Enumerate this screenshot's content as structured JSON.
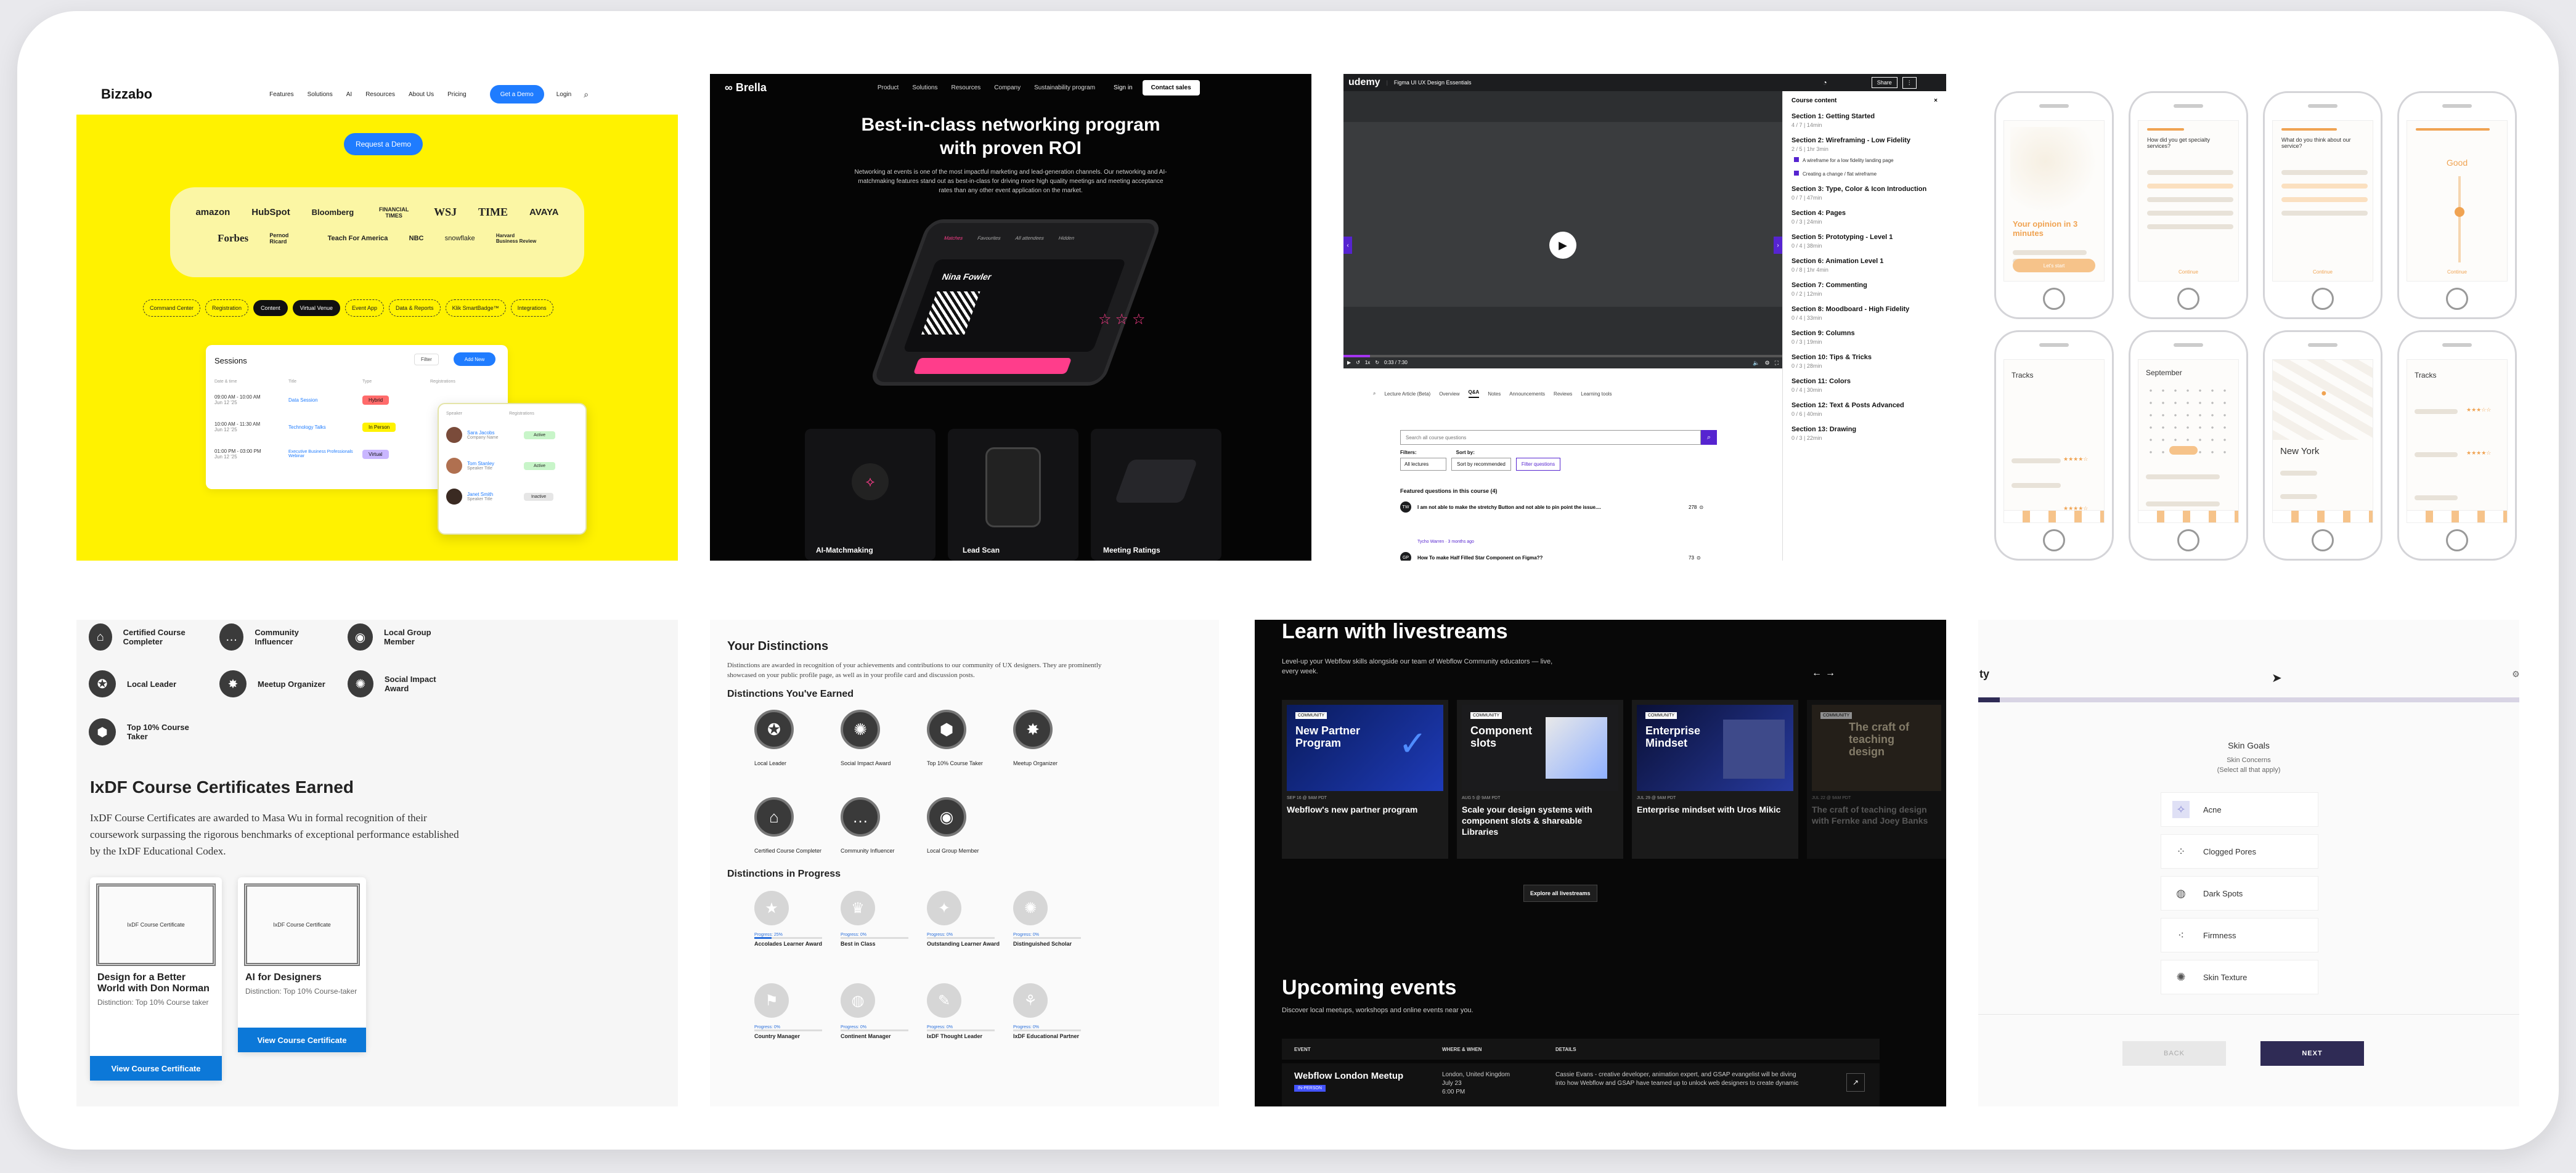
{
  "bizzabo": {
    "logo": "Bizzabo",
    "nav": [
      "Features",
      "Solutions",
      "AI",
      "Resources",
      "About Us",
      "Pricing"
    ],
    "cta": "Get a Demo",
    "login": "Login",
    "hero_button": "Request a Demo",
    "logos_row1": [
      "amazon",
      "HubSpot",
      "Bloomberg",
      "FINANCIAL TIMES",
      "WSJ",
      "TIME",
      "AVAYA"
    ],
    "logos_row2": [
      "Forbes",
      "Pernod Ricard",
      "Teach For America",
      "NBC",
      "snowflake",
      "Harvard Business Review"
    ],
    "chips": [
      "Command Center",
      "Registration",
      "Content",
      "Virtual Venue",
      "Event App",
      "Data & Reports",
      "Klik SmartBadge™",
      "Integrations"
    ],
    "card_title": "Sessions",
    "card_select": "Filter",
    "card_button": "Add New",
    "table_headers": [
      "Date & time",
      "Title",
      "Type",
      "Registrations"
    ],
    "rows": [
      {
        "date": "09:00 AM - 10:00 AM",
        "day": "Jun 12 '25",
        "title": "Data Session",
        "type": "Hybrid"
      },
      {
        "date": "10:00 AM - 11:30 AM",
        "day": "Jun 12 '25",
        "title": "Technology Talks",
        "type": "In Person"
      },
      {
        "date": "01:00 PM - 03:00 PM",
        "day": "Jun 12 '25",
        "title": "Executive Business Professionals Webinar",
        "type": "Virtual"
      }
    ],
    "popup_headers": [
      "Speaker",
      "Registrations"
    ],
    "popup_people": [
      {
        "name": "Sara Jacobs",
        "role": "Company Name",
        "status": "Active"
      },
      {
        "name": "Tom Stanley",
        "role": "Speaker Title",
        "status": "Active"
      },
      {
        "name": "Janet Smith",
        "role": "Speaker Title",
        "status": "Inactive"
      }
    ]
  },
  "brella": {
    "logo": "Brella",
    "nav": [
      "Product",
      "Solutions",
      "Resources",
      "Company",
      "Sustainability program"
    ],
    "signin": "Sign in",
    "cta": "Contact sales",
    "headline_1": "Best-in-class networking program",
    "headline_2": "with proven ROI",
    "paragraph": "Networking at events is one of the most impactful marketing and lead-generation channels. Our networking and AI-matchmaking features stand out as best-in-class for driving more high quality meetings and meeting acceptance rates than any other event application on the market.",
    "phone_name": "Nina Fowler",
    "phone_tabs": [
      "Matches",
      "Favourites",
      "All attendees",
      "Hidden"
    ],
    "features": [
      "AI-Matchmaking",
      "Lead Scan",
      "Meeting Ratings"
    ]
  },
  "udemy": {
    "logo": "udemy",
    "course_title": "Figma UI UX Design Essentials",
    "topbar_button": "Share",
    "sidebar_title": "Course content",
    "sections": [
      {
        "title": "Section 1: Getting Started",
        "meta": "4 / 7 | 14min"
      },
      {
        "title": "Section 2: Wireframing - Low Fidelity",
        "meta": "2 / 5 | 1hr 3min"
      },
      {
        "title": "Section 3: Type, Color & Icon Introduction",
        "meta": "0 / 7 | 47min"
      },
      {
        "title": "Section 4: Pages",
        "meta": "0 / 3 | 24min"
      },
      {
        "title": "Section 5: Prototyping - Level 1",
        "meta": "0 / 4 | 38min"
      },
      {
        "title": "Section 6: Animation Level 1",
        "meta": "0 / 8 | 1hr 4min"
      },
      {
        "title": "Section 7: Commenting",
        "meta": "0 / 2 | 12min"
      },
      {
        "title": "Section 8: Moodboard - High Fidelity",
        "meta": "0 / 4 | 33min"
      },
      {
        "title": "Section 9: Columns",
        "meta": "0 / 3 | 19min"
      },
      {
        "title": "Section 10: Tips & Tricks",
        "meta": "0 / 3 | 28min"
      },
      {
        "title": "Section 11: Colors",
        "meta": "0 / 4 | 30min"
      },
      {
        "title": "Section 12: Text & Posts Advanced",
        "meta": "0 / 6 | 40min"
      },
      {
        "title": "Section 13: Drawing",
        "meta": "0 / 3 | 22min"
      }
    ],
    "lectures": [
      "A wireframe for a low fidelity landing page",
      "Creating a change / flat wireframe"
    ],
    "time": "0:33 / 7:30",
    "tabs": [
      "Lecture Article (Beta)",
      "Overview",
      "Q&A",
      "Notes",
      "Announcements",
      "Reviews",
      "Learning tools"
    ],
    "search_placeholder": "Search all course questions",
    "filters_label": "Filters:",
    "sort_label": "Sort by:",
    "filter_buttons": [
      "All lectures",
      "Sort by recommended",
      "Filter questions"
    ],
    "featured": "Featured questions in this course (4)",
    "questions": [
      {
        "text": "I am not able to make the stretchy Button and not able to pin point the issue....",
        "count": "278"
      },
      {
        "text": "How To make Half Filled Star Component on Figma??",
        "count": "73"
      }
    ],
    "question_meta": "Tycho Warren · 3 months ago"
  },
  "mobile": {
    "phones": [
      {
        "title": "Your opinion in 3 minutes",
        "button": "Let's start"
      },
      {
        "title": "How did you get specialty services?",
        "button": "Continue"
      },
      {
        "title": "What do you think about our service?",
        "button": "Continue"
      },
      {
        "title": "Good",
        "button": "Continue"
      },
      {
        "title": "Tracks",
        "button": ""
      },
      {
        "title": "September",
        "button": ""
      },
      {
        "title": "New York",
        "button": ""
      },
      {
        "title": "Tracks",
        "button": ""
      }
    ],
    "accent": "#f0a352"
  },
  "ixdf": {
    "badges": [
      "Certified Course Completer",
      "Community Influencer",
      "Local Group Member",
      "Local Leader",
      "Meetup Organizer",
      "Social Impact Award",
      "Top 10% Course Taker"
    ],
    "heading": "IxDF Course Certificates Earned",
    "paragraph": "IxDF Course Certificates are awarded to Masa Wu in formal recognition of their coursework surpassing the rigorous benchmarks of exceptional performance established by the IxDF Educational Codex.",
    "cert_caption": "IxDF Course Certificate",
    "certs": [
      {
        "title": "Design for a Better World with Don Norman",
        "distinction": "Distinction: Top 10% Course taker",
        "button": "View Course Certificate"
      },
      {
        "title": "AI for Designers",
        "distinction": "Distinction: Top 10% Course-taker",
        "button": "View Course Certificate"
      }
    ]
  },
  "distinctions": {
    "title": "Your Distinctions",
    "intro": "Distinctions are awarded in recognition of your achievements and contributions to our community of UX designers. They are prominently showcased on your public profile page, as well as in your profile card and discussion posts.",
    "earned_title": "Distinctions You've Earned",
    "earned": [
      "Local Leader",
      "Social Impact Award",
      "Top 10% Course Taker",
      "Meetup Organizer",
      "Certified Course Completer",
      "Community Influencer",
      "Local Group Member"
    ],
    "progress_title": "Distinctions in Progress",
    "progress": [
      {
        "label": "Progress: 25%",
        "name": "Accolades Learner Award"
      },
      {
        "label": "Progress: 0%",
        "name": "Best in Class"
      },
      {
        "label": "Progress: 0%",
        "name": "Outstanding Learner Award"
      },
      {
        "label": "Progress: 0%",
        "name": "Distinguished Scholar"
      },
      {
        "label": "Progress: 0%",
        "name": "Country Manager"
      },
      {
        "label": "Progress: 0%",
        "name": "Continent Manager"
      },
      {
        "label": "Progress: 0%",
        "name": "IxDF Thought Leader"
      },
      {
        "label": "Progress: 0%",
        "name": "IxDF Educational Partner"
      }
    ]
  },
  "webflow": {
    "title": "Learn with livestreams",
    "subtitle": "Level-up your Webflow skills alongside our team of Webflow Community educators — live, every week.",
    "cards": [
      {
        "thumb": "New Partner Program",
        "tag": "COMMUNITY",
        "date": "SEP 16 @ 9AM PDT",
        "title": "Webflow's new partner program"
      },
      {
        "thumb": "Component slots",
        "tag": "COMMUNITY",
        "date": "AUG 5 @ 9AM PDT",
        "title": "Scale your design systems with component slots & shareable Libraries"
      },
      {
        "thumb": "Enterprise Mindset",
        "tag": "COMMUNITY",
        "date": "JUL 29 @ 9AM PDT",
        "title": "Enterprise mindset with Uros Mikic"
      },
      {
        "thumb": "The craft of teaching design",
        "tag": "COMMUNITY",
        "date": "JUL 22 @ 9AM PDT",
        "title": "The craft of teaching design with Fernke and Joey Banks"
      }
    ],
    "explore": "Explore all livestreams",
    "events_title": "Upcoming events",
    "events_sub": "Discover local meetups, workshops and online events near you.",
    "cols": [
      "EVENT",
      "WHERE & WHEN",
      "DETAILS"
    ],
    "event_name": "Webflow London Meetup",
    "event_tag": "IN-PERSON",
    "event_where": "London, United Kingdom",
    "event_when": "July 23",
    "event_time": "6:00 PM",
    "event_details": "Cassie Evans - creative developer, animation expert, and GSAP evangelist will be diving into how Webflow and GSAP have teamed up to unlock web designers to create dynamic"
  },
  "skin": {
    "brand": "ty",
    "title": "Skin Goals",
    "sub": "Skin Concerns",
    "note": "(Select all that apply)",
    "options": [
      "Acne",
      "Clogged Pores",
      "Dark Spots",
      "Firmness",
      "Skin Texture"
    ],
    "back": "BACK",
    "next": "NEXT"
  }
}
